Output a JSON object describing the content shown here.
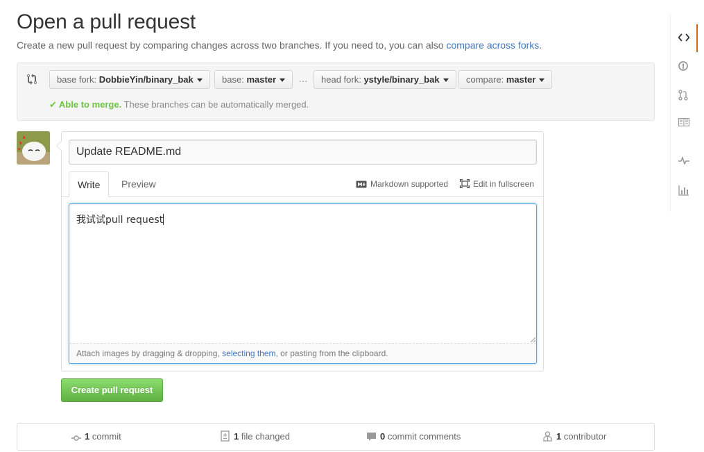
{
  "page": {
    "title": "Open a pull request",
    "subtitle_text": "Create a new pull request by comparing changes across two branches. If you need to, you can also ",
    "subtitle_link": "compare across forks",
    "subtitle_end": "."
  },
  "compare": {
    "base_fork_label": "base fork:",
    "base_fork_value": "DobbieYin/binary_bak",
    "base_label": "base:",
    "base_value": "master",
    "dots": "…",
    "head_fork_label": "head fork:",
    "head_fork_value": "ystyle/binary_bak",
    "compare_label": "compare:",
    "compare_value": "master",
    "merge_ok": "Able to merge.",
    "merge_text": "These branches can be automatically merged."
  },
  "form": {
    "title_value": "Update README.md",
    "tab_write": "Write",
    "tab_preview": "Preview",
    "markdown_supported": "Markdown supported",
    "edit_fullscreen": "Edit in fullscreen",
    "body_value": "我试试pull request",
    "attach_text_1": "Attach images by dragging & dropping, ",
    "attach_link": "selecting them",
    "attach_text_2": ", or pasting from the clipboard.",
    "submit_label": "Create pull request"
  },
  "stats": {
    "commits_count": "1",
    "commits_label": "commit",
    "files_count": "1",
    "files_label": "file changed",
    "comments_count": "0",
    "comments_label": "commit comments",
    "contributors_count": "1",
    "contributors_label": "contributor"
  },
  "colors": {
    "accent_link": "#4078c0",
    "merge_green": "#6cc644",
    "button_green": "#60b044",
    "nav_active": "#d26911"
  },
  "icons": [
    "git-compare-icon",
    "code-icon",
    "issue-opened-icon",
    "git-pull-request-icon",
    "book-icon",
    "pulse-icon",
    "graph-icon",
    "markdown-icon",
    "screen-full-icon",
    "git-commit-icon",
    "diff-icon",
    "comment-icon",
    "organization-icon",
    "check-icon"
  ]
}
